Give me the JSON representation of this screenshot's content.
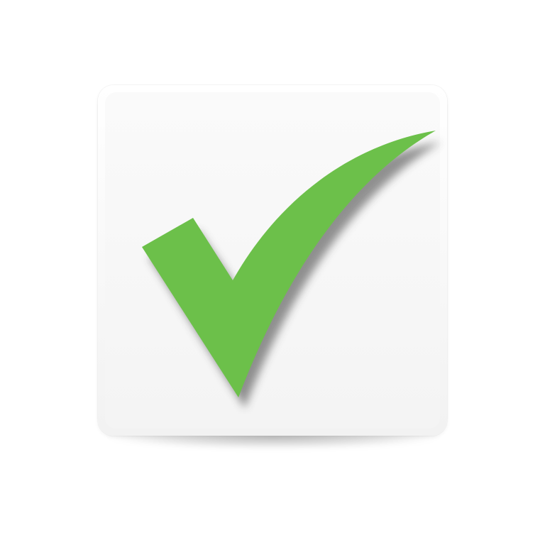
{
  "icon": {
    "name": "checkmark-icon",
    "tile_color": "#f5f5f5",
    "check_color": "#6cc04a",
    "shadow_color": "#5a5a5a"
  }
}
